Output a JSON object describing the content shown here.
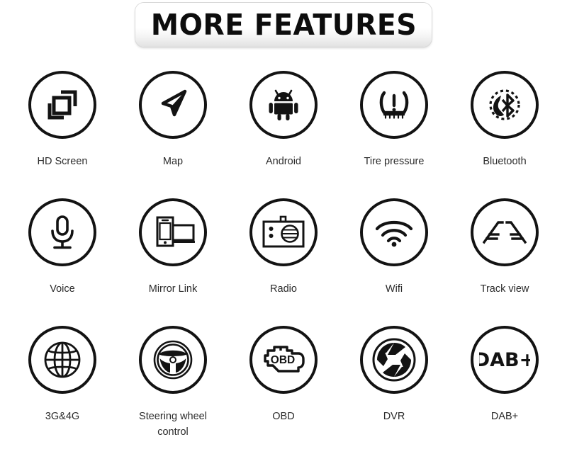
{
  "header": {
    "title": "MORE FEATURES"
  },
  "colors": {
    "ink": "#131313",
    "label": "#2b2b2b",
    "background": "#ffffff",
    "title_box_border": "#d8d8d8"
  },
  "features": [
    {
      "id": "hd-screen",
      "label": "HD Screen",
      "icon": "hd-screen-icon"
    },
    {
      "id": "map",
      "label": "Map",
      "icon": "navigation-arrow-icon"
    },
    {
      "id": "android",
      "label": "Android",
      "icon": "android-robot-icon"
    },
    {
      "id": "tire-pressure",
      "label": "Tire pressure",
      "icon": "tpms-warning-icon"
    },
    {
      "id": "bluetooth",
      "label": "Bluetooth",
      "icon": "bluetooth-phone-icon"
    },
    {
      "id": "voice",
      "label": "Voice",
      "icon": "microphone-icon"
    },
    {
      "id": "mirror-link",
      "label": "Mirror Link",
      "icon": "phone-screen-mirror-icon"
    },
    {
      "id": "radio",
      "label": "Radio",
      "icon": "radio-icon"
    },
    {
      "id": "wifi",
      "label": "Wifi",
      "icon": "wifi-icon"
    },
    {
      "id": "track-view",
      "label": "Track view",
      "icon": "track-guideline-icon"
    },
    {
      "id": "3g4g",
      "label": "3G&4G",
      "icon": "globe-icon"
    },
    {
      "id": "steering-wheel",
      "label": "Steering wheel control",
      "icon": "steering-wheel-icon"
    },
    {
      "id": "obd",
      "label": "OBD",
      "icon": "check-engine-obd-icon",
      "icon_text": "OBD"
    },
    {
      "id": "dvr",
      "label": "DVR",
      "icon": "camera-aperture-icon"
    },
    {
      "id": "dab-plus",
      "label": "DAB+",
      "icon": "dab-plus-logo-icon",
      "icon_text": "DAB+"
    }
  ]
}
